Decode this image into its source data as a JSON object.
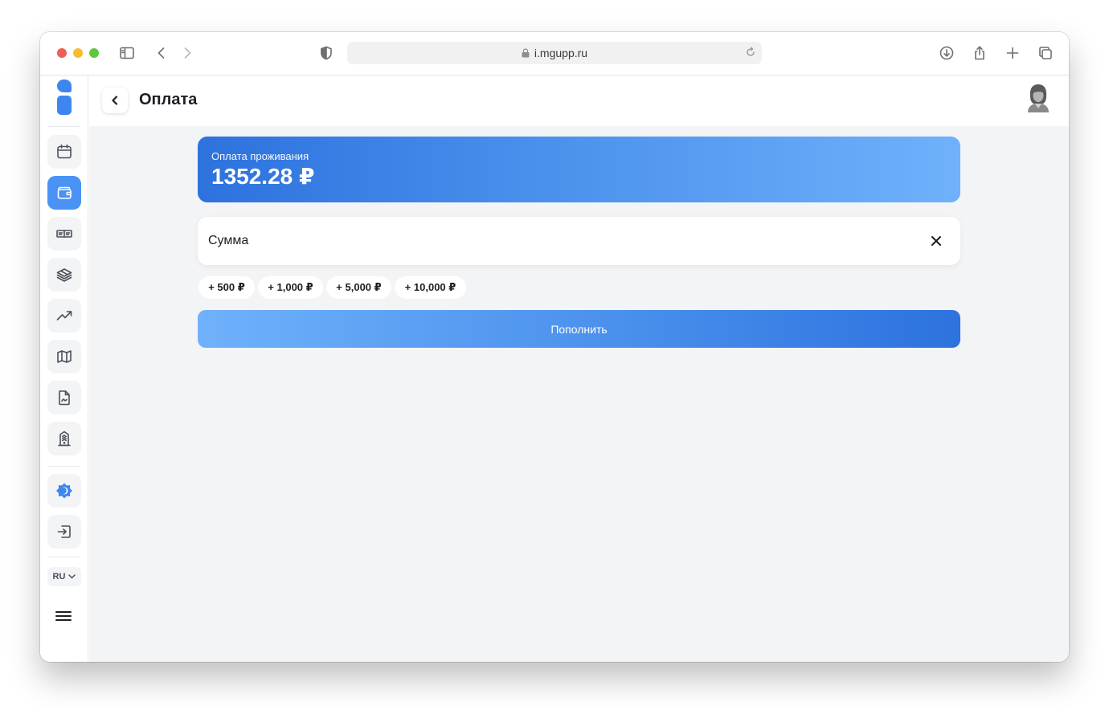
{
  "browser": {
    "url": "i.mgupp.ru"
  },
  "sidebar": {
    "items": [
      {
        "icon": "calendar-icon"
      },
      {
        "icon": "wallet-icon",
        "active": true
      },
      {
        "icon": "ticket-icon"
      },
      {
        "icon": "layers-icon"
      },
      {
        "icon": "trending-up-icon"
      },
      {
        "icon": "map-icon"
      },
      {
        "icon": "document-icon"
      },
      {
        "icon": "building-icon"
      },
      {
        "icon": "theme-icon"
      },
      {
        "icon": "logout-icon"
      }
    ],
    "language": "RU"
  },
  "header": {
    "title": "Оплата"
  },
  "balance": {
    "label": "Оплата проживания",
    "value": "1352.28 ₽"
  },
  "amount_field": {
    "placeholder": "Сумма"
  },
  "quick_amounts": [
    "+ 500 ₽",
    "+ 1,000 ₽",
    "+ 5,000 ₽",
    "+ 10,000 ₽"
  ],
  "submit_label": "Пополнить",
  "colors": {
    "accent": "#3d86f0",
    "gradient_dark": "#2d72de",
    "gradient_light": "#6fb1fb",
    "background": "#f3f4f6"
  }
}
